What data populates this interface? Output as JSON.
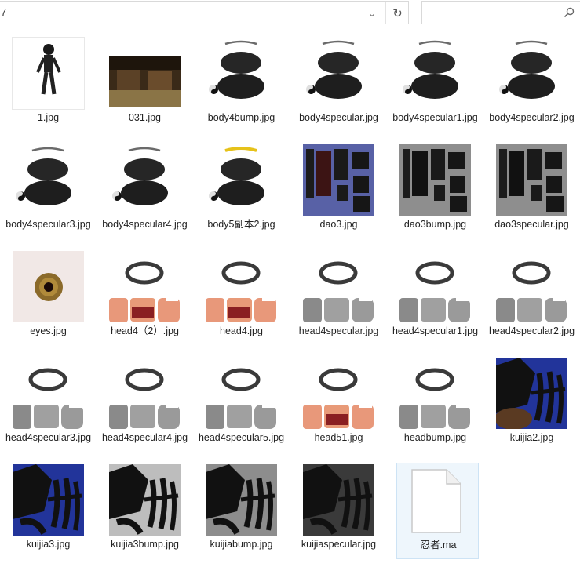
{
  "address": {
    "path": "7",
    "dropdown_icon": "chevron-down-icon",
    "refresh_icon": "refresh-icon"
  },
  "search": {
    "placeholder": "",
    "icon": "search-icon"
  },
  "files": [
    {
      "name": "1.jpg",
      "kind": "person"
    },
    {
      "name": "031.jpg",
      "kind": "scene"
    },
    {
      "name": "body4bump.jpg",
      "kind": "body"
    },
    {
      "name": "body4specular.jpg",
      "kind": "body"
    },
    {
      "name": "body4specular1.jpg",
      "kind": "body"
    },
    {
      "name": "body4specular2.jpg",
      "kind": "body"
    },
    {
      "name": "body4specular3.jpg",
      "kind": "body"
    },
    {
      "name": "body4specular4.jpg",
      "kind": "body"
    },
    {
      "name": "body5副本2.jpg",
      "kind": "body-yellow"
    },
    {
      "name": "dao3.jpg",
      "kind": "dao"
    },
    {
      "name": "dao3bump.jpg",
      "kind": "dao-gray"
    },
    {
      "name": "dao3specular.jpg",
      "kind": "dao-gray"
    },
    {
      "name": "eyes.jpg",
      "kind": "eye"
    },
    {
      "name": "head4（2）.jpg",
      "kind": "head-color"
    },
    {
      "name": "head4.jpg",
      "kind": "head-color"
    },
    {
      "name": "head4specular.jpg",
      "kind": "head-gray"
    },
    {
      "name": "head4specular1.jpg",
      "kind": "head-gray"
    },
    {
      "name": "head4specular2.jpg",
      "kind": "head-gray"
    },
    {
      "name": "head4specular3.jpg",
      "kind": "head-gray"
    },
    {
      "name": "head4specular4.jpg",
      "kind": "head-gray"
    },
    {
      "name": "head4specular5.jpg",
      "kind": "head-gray"
    },
    {
      "name": "head51.jpg",
      "kind": "head-color"
    },
    {
      "name": "headbump.jpg",
      "kind": "head-gray"
    },
    {
      "name": "kuijia2.jpg",
      "kind": "kuijia-blue-brown"
    },
    {
      "name": "kuijia3.jpg",
      "kind": "kuijia-blue"
    },
    {
      "name": "kuijia3bump.jpg",
      "kind": "kuijia-lightgray"
    },
    {
      "name": "kuijiabump.jpg",
      "kind": "kuijia-gray"
    },
    {
      "name": "kuijiaspecular.jpg",
      "kind": "kuijia-dark"
    },
    {
      "name": "忍者.ma",
      "kind": "document"
    }
  ]
}
